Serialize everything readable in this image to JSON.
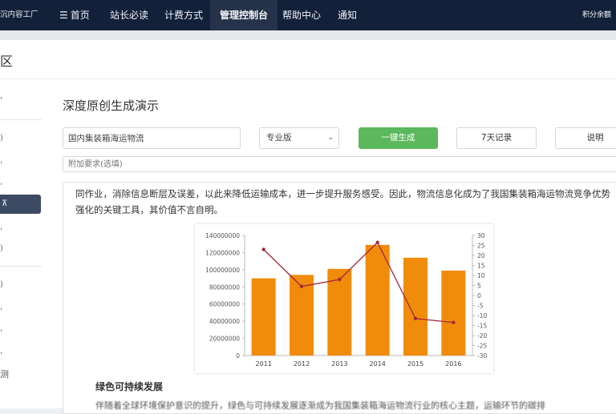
{
  "nav": {
    "brand": "沉内容工厂",
    "items": [
      {
        "icon": "menu-icon",
        "label": "首页"
      },
      {
        "label": "站长必读"
      },
      {
        "label": "计费方式"
      },
      {
        "label": "管理控制台"
      },
      {
        "label": "帮助中心"
      },
      {
        "label": "通知"
      }
    ],
    "points_label": "积分余额"
  },
  "section_title": "区",
  "sidebar": {
    "bottom_label": "测"
  },
  "form": {
    "title": "深度原创生成演示",
    "topic_value": "国内集装箱海运物流",
    "edition_value": "专业版",
    "generate_label": "一键生成",
    "records_label": "7天记录",
    "help_label": "说明",
    "extra_placeholder": "附加要求(选填)"
  },
  "article": {
    "paragraph": "同作业，消除信息断层及误差，以此来降低运输成本，进一步提升服务感受。因此，物流信息化成为了我国集装箱海运物流竞争优势强化的关键工具，其价值不言自明。",
    "subheading": "绿色可持续发展",
    "paragraph2": "伴随着全球环境保护意识的提升，绿色与可持续发展逐渐成为我国集装箱海运物流行业的核心主题，运输环节的碳排"
  },
  "colors": {
    "bar": "#f08c0a",
    "line": "#a4283b",
    "nav_bg": "#13203a",
    "primary_button": "#5cb85c"
  },
  "chart_data": {
    "type": "bar",
    "categories": [
      "2011",
      "2012",
      "2013",
      "2014",
      "2015",
      "2016"
    ],
    "series": [
      {
        "type": "bar",
        "axis": "left",
        "values": [
          90000000,
          94000000,
          101000000,
          129000000,
          114000000,
          99000000
        ]
      },
      {
        "type": "line",
        "axis": "right",
        "values": [
          23,
          4.5,
          8,
          26.5,
          -11.5,
          -13.5
        ]
      }
    ],
    "y_left": {
      "min": 0,
      "max": 140000000,
      "ticks": [
        "0",
        "20000000",
        "40000000",
        "60000000",
        "80000000",
        "100000000",
        "120000000",
        "140000000"
      ]
    },
    "y_right": {
      "min": -30,
      "max": 30,
      "ticks": [
        "-30",
        "-25",
        "-20",
        "-15",
        "-10",
        "-5",
        "0",
        "5",
        "10",
        "15",
        "20",
        "25",
        "30"
      ]
    },
    "grid": false,
    "legend": "none"
  }
}
